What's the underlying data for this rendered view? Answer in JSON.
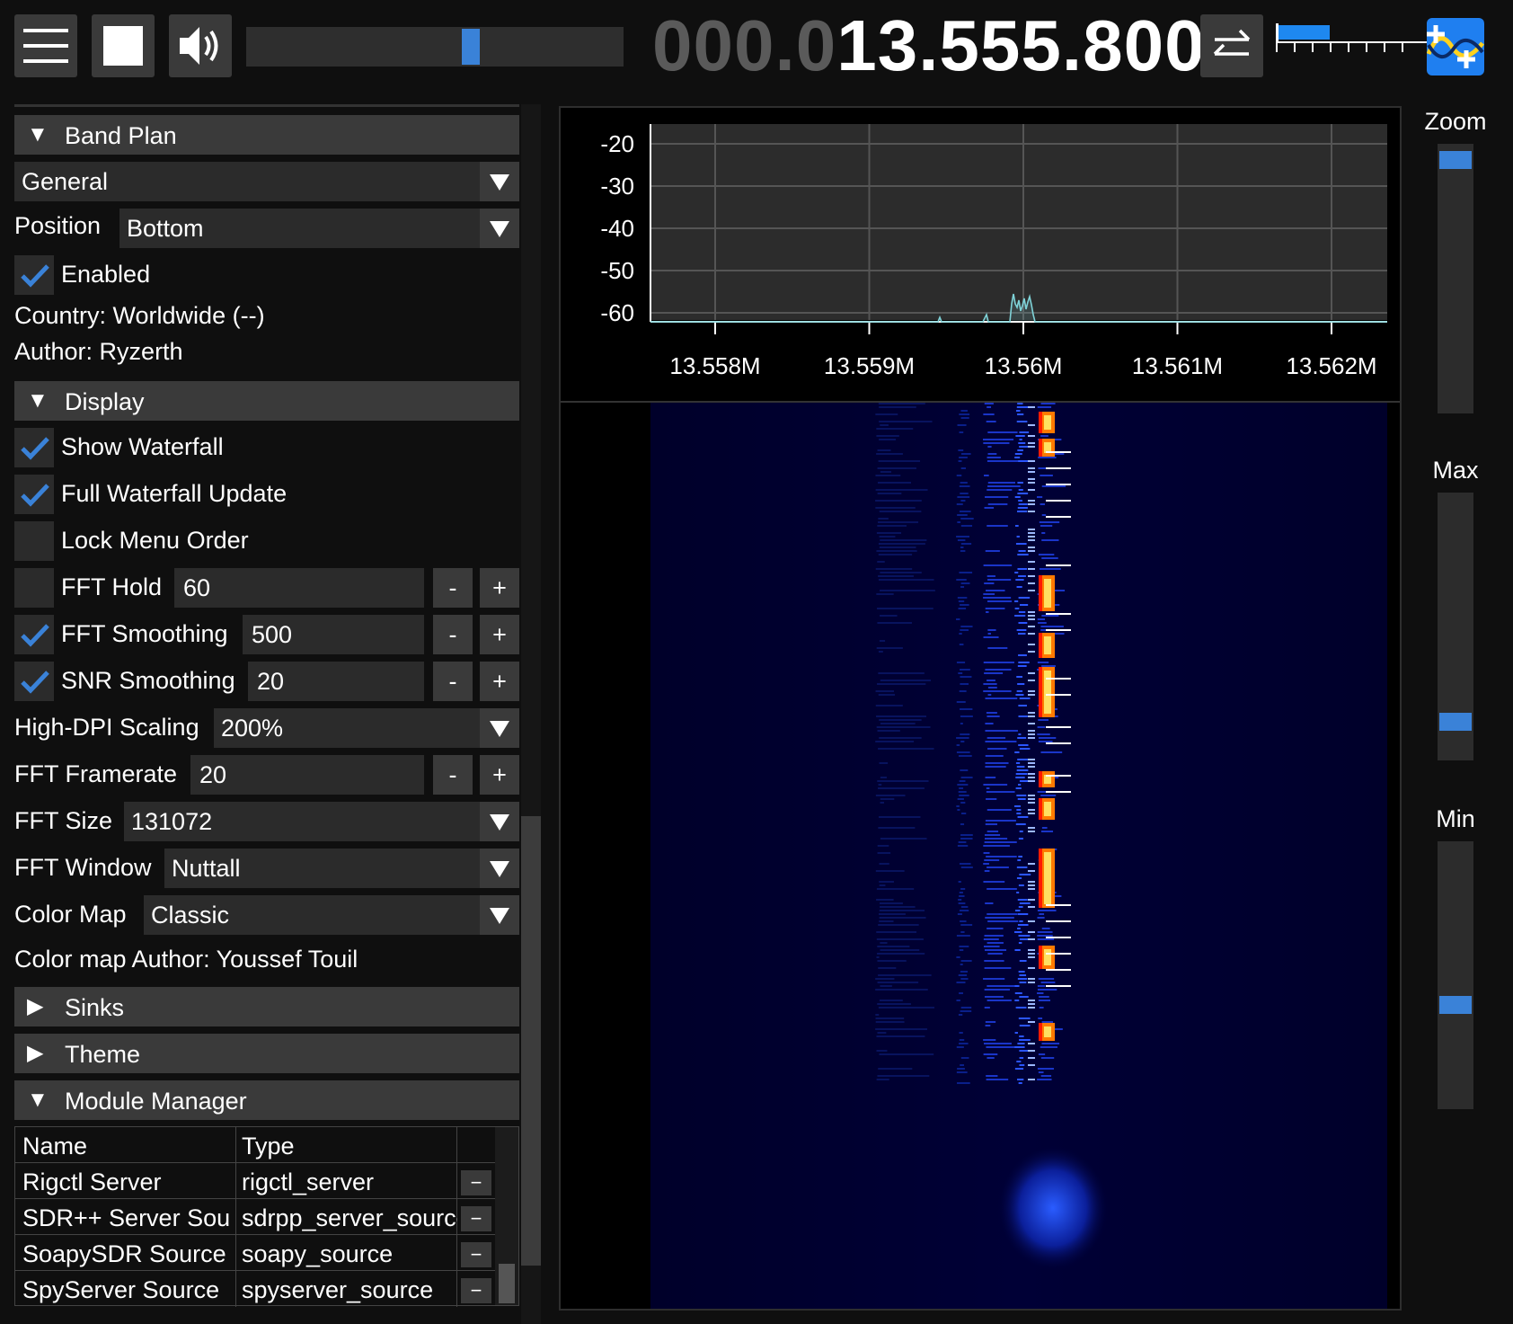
{
  "topbar": {
    "volume_level": 0.6,
    "frequency_dim": "000.0",
    "frequency_bright": "13.555.800",
    "snr_scale": [
      "0",
      "10",
      "20",
      "30",
      "40",
      "50",
      "60",
      "70"
    ],
    "snr_level": 0.4
  },
  "band_plan": {
    "header": "Band Plan",
    "plan": "General",
    "position_label": "Position",
    "position": "Bottom",
    "enabled_label": "Enabled",
    "enabled": true,
    "country": "Country: Worldwide (--)",
    "author": "Author: Ryzerth"
  },
  "display": {
    "header": "Display",
    "show_waterfall": {
      "label": "Show Waterfall",
      "checked": true
    },
    "full_waterfall_update": {
      "label": "Full Waterfall Update",
      "checked": true
    },
    "lock_menu_order": {
      "label": "Lock Menu Order",
      "checked": false
    },
    "fft_hold": {
      "label": "FFT Hold",
      "checked": false,
      "value": "60"
    },
    "fft_smoothing": {
      "label": "FFT Smoothing",
      "checked": true,
      "value": "500"
    },
    "snr_smoothing": {
      "label": "SNR Smoothing",
      "checked": true,
      "value": "20"
    },
    "high_dpi": {
      "label": "High-DPI Scaling",
      "value": "200%"
    },
    "fft_framerate": {
      "label": "FFT Framerate",
      "value": "20"
    },
    "fft_size": {
      "label": "FFT Size",
      "value": "131072"
    },
    "fft_window": {
      "label": "FFT Window",
      "value": "Nuttall"
    },
    "color_map": {
      "label": "Color Map",
      "value": "Classic"
    },
    "color_map_author": "Color map Author: Youssef Touil",
    "minus": "-",
    "plus": "+"
  },
  "sinks": {
    "header": "Sinks"
  },
  "theme": {
    "header": "Theme"
  },
  "module_manager": {
    "header": "Module Manager",
    "columns": [
      "Name",
      "Type"
    ],
    "rows": [
      {
        "name": "Rigctl Server",
        "type": "rigctl_server"
      },
      {
        "name": "SDR++ Server Source",
        "type": "sdrpp_server_source"
      },
      {
        "name": "SoapySDR Source",
        "type": "soapy_source"
      },
      {
        "name": "SpyServer Source",
        "type": "spyserver_source"
      }
    ],
    "remove_label": "−"
  },
  "fft": {
    "y_ticks": [
      "-20",
      "-30",
      "-40",
      "-50",
      "-60"
    ],
    "x_ticks": [
      "13.558M",
      "13.559M",
      "13.56M",
      "13.561M",
      "13.562M"
    ]
  },
  "sliders": {
    "zoom_label": "Zoom",
    "max_label": "Max",
    "min_label": "Min",
    "zoom_level": 0.97,
    "max_level": 0.12,
    "min_level": 0.38
  },
  "colors": {
    "accent": "#3a82d8",
    "panel_header": "#3a3a3a",
    "background": "#0f0f0f"
  }
}
